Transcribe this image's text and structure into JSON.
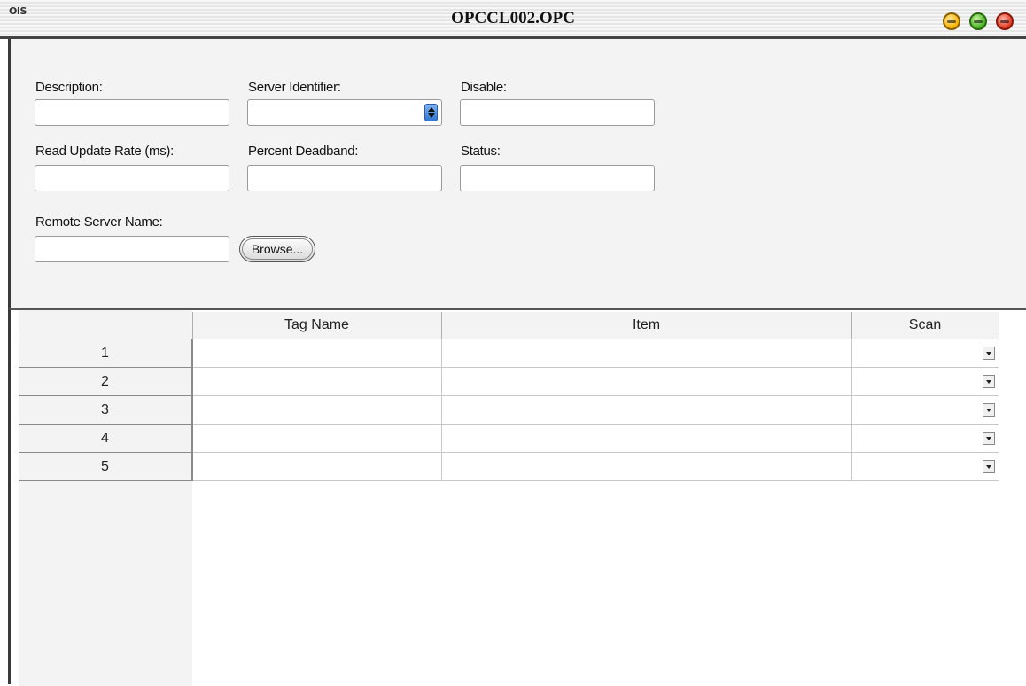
{
  "window": {
    "app_label": "OIS",
    "title": "OPCCL002.OPC"
  },
  "form": {
    "description_label": "Description:",
    "server_identifier_label": "Server Identifier:",
    "disable_label": "Disable:",
    "read_update_rate_label": "Read Update Rate (ms):",
    "percent_deadband_label": "Percent Deadband:",
    "status_label": "Status:",
    "remote_server_name_label": "Remote Server Name:",
    "browse_label": "Browse..."
  },
  "grid": {
    "columns": [
      "Tag Name",
      "Item",
      "Scan"
    ],
    "rows": [
      {
        "num": "1",
        "tag_name": "",
        "item": "",
        "scan": ""
      },
      {
        "num": "2",
        "tag_name": "",
        "item": "",
        "scan": ""
      },
      {
        "num": "3",
        "tag_name": "",
        "item": "",
        "scan": ""
      },
      {
        "num": "4",
        "tag_name": "",
        "item": "",
        "scan": ""
      },
      {
        "num": "5",
        "tag_name": "",
        "item": "",
        "scan": ""
      }
    ]
  }
}
